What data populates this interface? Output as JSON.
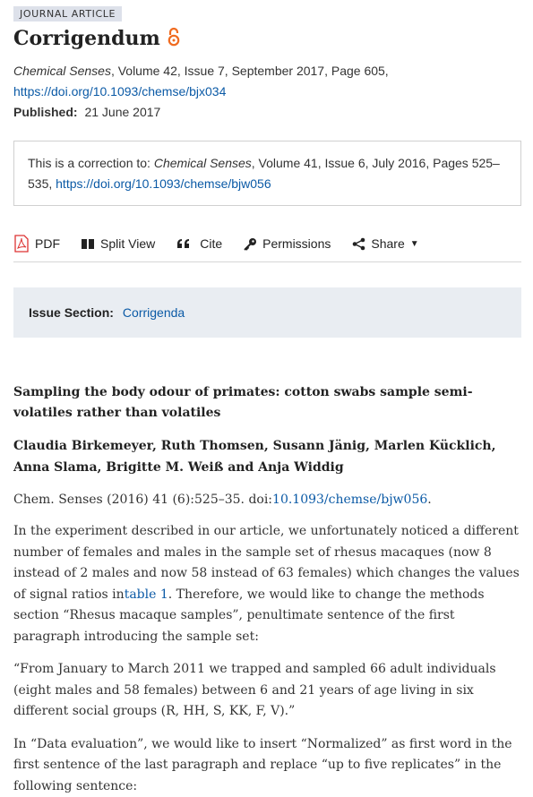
{
  "header": {
    "badge": "JOURNAL ARTICLE",
    "title": "Corrigendum",
    "open_access_icon": "open-access-icon",
    "journal": "Chemical Senses",
    "citation_rest": ", Volume 42, Issue 7, September 2017, Page 605,",
    "doi": "https://doi.org/10.1093/chemse/bjx034",
    "published_label": "Published:",
    "published_date": "21 June 2017"
  },
  "correction": {
    "prefix": "This is a correction to: ",
    "journal": "Chemical Senses",
    "details": ", Volume 41, Issue 6, July 2016, Pages 525–535, ",
    "doi": "https://doi.org/10.1093/chemse/bjw056"
  },
  "toolbar": {
    "pdf": "PDF",
    "split_view": "Split View",
    "cite": "Cite",
    "permissions": "Permissions",
    "share": "Share"
  },
  "issue_section": {
    "label": "Issue Section:",
    "value": "Corrigenda"
  },
  "article": {
    "title": "Sampling the body odour of primates: cotton swabs sample semi-volatiles rather than volatiles",
    "authors": "Claudia Birkemeyer, Ruth Thomsen, Susann Jänig, Marlen Kücklich, Anna Slama, Brigitte M. Weiß and Anja Widdig",
    "ref_prefix": "Chem. Senses (2016) 41 (6):525–35. doi:",
    "ref_doi": "10.1093/chemse/bjw056",
    "ref_suffix": ".",
    "p1_a": "In the experiment described in our article, we unfortunately noticed a different number of females and males in the sample set of rhesus macaques (now 8 instead of 2 males and now 58 instead of 63 females) which changes the values of signal ratios in",
    "p1_link": "table 1",
    "p1_b": ". Therefore, we would like to change the methods section “Rhesus macaque samples”, penultimate sentence of the first paragraph introducing the sample set:",
    "p2": "“From January to March 2011 we trapped and sampled 66 adult individuals (eight males and 58 females) between 6 and 21 years of age living in six different social groups (R, HH, S, KK, F, V).”",
    "p3": "In “Data evaluation”, we would like to insert “Normalized” as first word in the first sentence of the last paragraph and replace “up to five replicates” in the following sentence:"
  }
}
